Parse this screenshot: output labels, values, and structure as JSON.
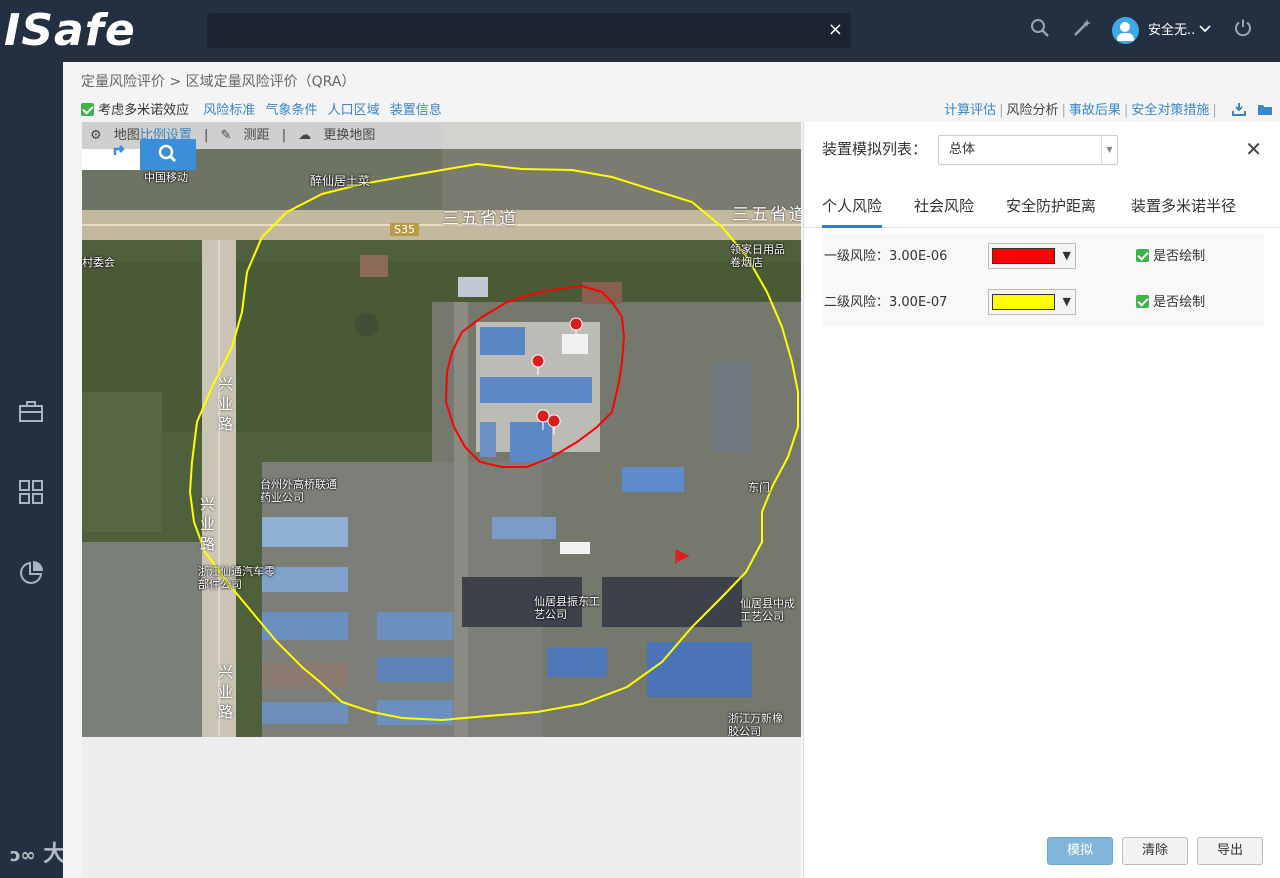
{
  "app": {
    "logo_text": "ISafe",
    "search_clear": "×",
    "user_name": "安全无..",
    "user_caret": "⌄"
  },
  "breadcrumb": "定量风险评价 > 区域定量风险评价（QRA）",
  "subnav": {
    "domino_label": "考虑多米诺效应",
    "links": [
      "风险标准",
      "气象条件",
      "人口区域",
      "装置信息"
    ]
  },
  "rightnav": {
    "links": [
      "计算评估",
      "风险分析",
      "事故后果",
      "安全对策措施"
    ]
  },
  "map": {
    "toolbar": {
      "map_label": "地图",
      "scale_label": "比例设置",
      "measure_label": "测距",
      "change_map_label": "更换地图"
    },
    "labels": {
      "china_mobile": "中国移动",
      "restaurant": "醉仙居土菜",
      "road_a": "三五省道",
      "road_b": "三五省道",
      "s35": "S35",
      "village": "村委会",
      "store": "领家日用品卷烟店",
      "xingye_1": "兴业路",
      "xingye_2": "兴业路",
      "xingye_3": "兴业路",
      "pharma": "台州外高桥联通药业公司",
      "east_gate": "东门",
      "auto_parts": "浙江仙通汽车零部件公司",
      "zhendong": "仙居县振东工艺公司",
      "chengji": "仙居县中成工艺公司",
      "rubber": "浙江万新橡胶公司"
    }
  },
  "panel": {
    "title": "装置模拟列表：",
    "select_value": "总体",
    "close": "✕",
    "tabs": [
      "个人风险",
      "社会风险",
      "安全防护距离",
      "装置多米诺半径"
    ],
    "rows": [
      {
        "label": "一级风险：3.00E-06",
        "color": "#ff0000",
        "draw_label": "是否绘制"
      },
      {
        "label": "二级风险：3.00E-07",
        "color": "#ffff00",
        "draw_label": "是否绘制"
      }
    ],
    "buttons": {
      "simulate": "模拟",
      "clear": "清除",
      "export": "导出"
    }
  },
  "watermark": "大数跨境",
  "colors": {
    "topbar": "#233041",
    "accent": "#3a86c8",
    "primary_button": "#82b5db",
    "risk_contour_1": "#ff0000",
    "risk_contour_2": "#ffff00"
  }
}
